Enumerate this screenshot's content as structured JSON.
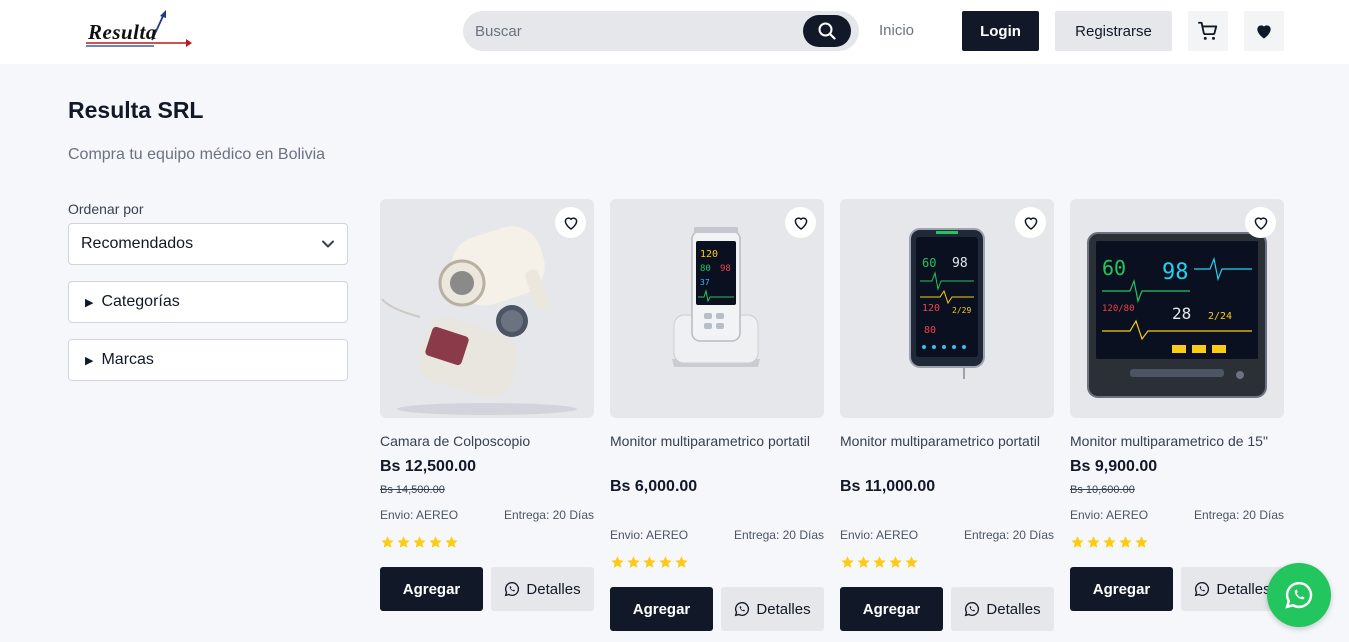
{
  "header": {
    "logo_text": "Resulta",
    "search": {
      "placeholder": "Buscar"
    },
    "nav_inicio": "Inicio",
    "login_label": "Login",
    "register_label": "Registrarse"
  },
  "page": {
    "title": "Resulta SRL",
    "subtitle": "Compra tu equipo médico en Bolivia"
  },
  "filters": {
    "sort_label": "Ordenar por",
    "sort_value": "Recomendados",
    "categories_label": "Categorías",
    "brands_label": "Marcas"
  },
  "products": [
    {
      "name": "Camara de Colposcopio",
      "price": "Bs 12,500.00",
      "old_price": "Bs 14,500.00",
      "envio": "Envio: AEREO",
      "entrega": "Entrega: 20 Días",
      "rating": 5,
      "add_label": "Agregar",
      "details_label": "Detalles"
    },
    {
      "name": "Monitor multiparametrico portatil",
      "price": "Bs 6,000.00",
      "old_price": "",
      "envio": "Envio: AEREO",
      "entrega": "Entrega: 20 Días",
      "rating": 5,
      "add_label": "Agregar",
      "details_label": "Detalles"
    },
    {
      "name": "Monitor multiparametrico portatil",
      "price": "Bs 11,000.00",
      "old_price": "",
      "envio": "Envio: AEREO",
      "entrega": "Entrega: 20 Días",
      "rating": 5,
      "add_label": "Agregar",
      "details_label": "Detalles"
    },
    {
      "name": "Monitor multiparametrico de 15\"",
      "price": "Bs 9,900.00",
      "old_price": "Bs 10,600.00",
      "envio": "Envio: AEREO",
      "entrega": "Entrega: 20 Días",
      "rating": 5,
      "add_label": "Agregar",
      "details_label": "Detalles"
    }
  ],
  "icons": {
    "search": "search-icon",
    "cart": "cart-icon",
    "favorites": "heart-icon",
    "whatsapp": "whatsapp-icon"
  },
  "colors": {
    "primary": "#111827",
    "star": "#facc15",
    "whatsapp": "#22c55e",
    "background": "#f5f7fa"
  }
}
